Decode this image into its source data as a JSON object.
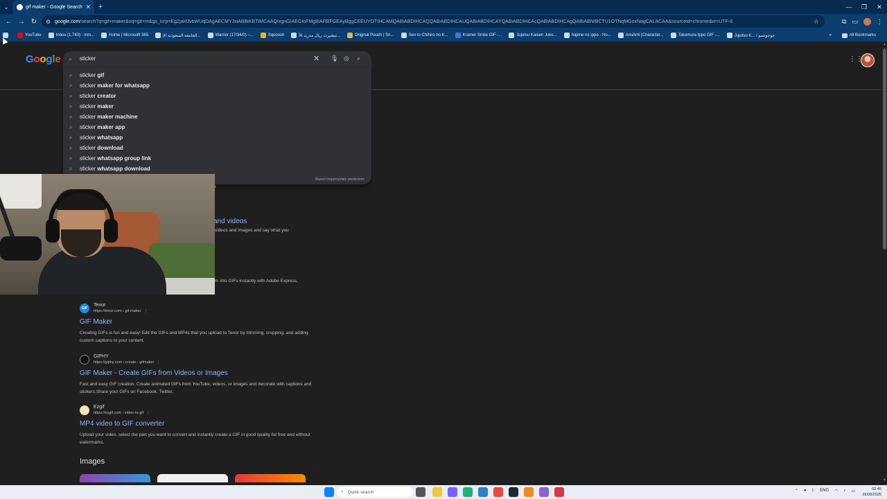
{
  "browser": {
    "tab": {
      "title": "gif maker - Google Search",
      "favicon": "google-icon",
      "close": "✕"
    },
    "new_tab": "+",
    "window_controls": [
      "—",
      "❐",
      "✕"
    ],
    "url_host": "google.com",
    "url_rest": "/search?q=gif+maker&oq=gif+m&gs_lcrp=EgZjaHJvbWUqDAgAECMYJxiABBiKBTIMCAAQIxgnGIAEGIoFMg8IARBFGEAyBggCEEUYOTIHCAMQABiABDIHCAQQABiABDIHCAUQABiABDIHCAYQABiABDIHCAcQABiABDIHCAgQABiABNIBCTU1OTNqMGoxNagCALACAA&sourceid=chrome&ie=UTF-8",
    "bookmarks": [
      "YouTube",
      "Inbox (1,740) - mm...",
      "Home | Microsoft 365",
      "الجامعة السعودية الإ...",
      "Warrior (17/34/0) –...",
      "Squoosh",
      "تيشيرت ريال مدريد الأ...",
      "Original Pouch | Sn...",
      "Sen to Chihiro no K...",
      "Kramer Smile GIF -...",
      "Jujutsu Kaisen Juko...",
      "hajime no ippo - Ho...",
      "AmiAmi [Character...",
      "Takamura Ippo GIF -...",
      "Jujutsu K... / جوجوتسو"
    ],
    "bookmarks_more": "»",
    "all_bookmarks": "All Bookmarks"
  },
  "google": {
    "logo": [
      "G",
      "o",
      "o",
      "g",
      "l",
      "e"
    ],
    "query": "sticker",
    "suggestions": [
      {
        "prefix": "sticker",
        "bold": " gif"
      },
      {
        "prefix": "sticker",
        "bold": " maker for whatsapp"
      },
      {
        "prefix": "sticker",
        "bold": " creator"
      },
      {
        "prefix": "sticker",
        "bold": " maker"
      },
      {
        "prefix": "sticker",
        "bold": " maker machine"
      },
      {
        "prefix": "sticker",
        "bold": " maker app"
      },
      {
        "prefix": "sticker",
        "bold": " whatsapp"
      },
      {
        "prefix": "sticker",
        "bold": " download"
      },
      {
        "prefix": "sticker",
        "bold": " whatsapp group link"
      },
      {
        "prefix": "sticker",
        "bold": " whatsapp download"
      }
    ],
    "report": "Report inappropriate predictions",
    "fragments": {
      "link": "and videos",
      "line1": "videos and images and say what you",
      "line2": "m into GIFs instantly with Adobe Express,",
      "dot": "o"
    },
    "results": [
      {
        "site": "Tenor",
        "url": "https://tenor.com › gif-maker",
        "title": "GIF Maker",
        "snippet": "Creating GIFs is fun and easy! Edit the GIFs and MP4s that you upload to Tenor by trimming, cropping, and adding custom captions to your content.",
        "fav": "GIF"
      },
      {
        "site": "GIPHY",
        "url": "https://giphy.com › create › gifmaker",
        "title": "GIF Maker - Create GIFs from Videos or Images",
        "snippet": "Fast and easy GIF creation. Create animated GIFs from YouTube, videos, or images and decorate with captions and stickers.Share your GIFs on Facebook, Twitter,",
        "fav": ""
      },
      {
        "site": "Ezgif",
        "url": "https://ezgif.com › video-to-gif",
        "title": "MP4 video to GIF converter",
        "snippet": "Upload your video, select the part you want to convert and instantly create a GIF in good quality for free and without watermarks.",
        "fav": ""
      }
    ],
    "images_heading": "Images"
  },
  "taskbar": {
    "search_placeholder": "Quick search",
    "tray_lang": "ENG",
    "time": "02:45",
    "date": "26/08/2025"
  },
  "colors": {
    "chrome_dark": "#062a50",
    "chrome": "#0b3d6e",
    "page_bg": "#1f1f1f",
    "link": "#8ab4f8"
  }
}
